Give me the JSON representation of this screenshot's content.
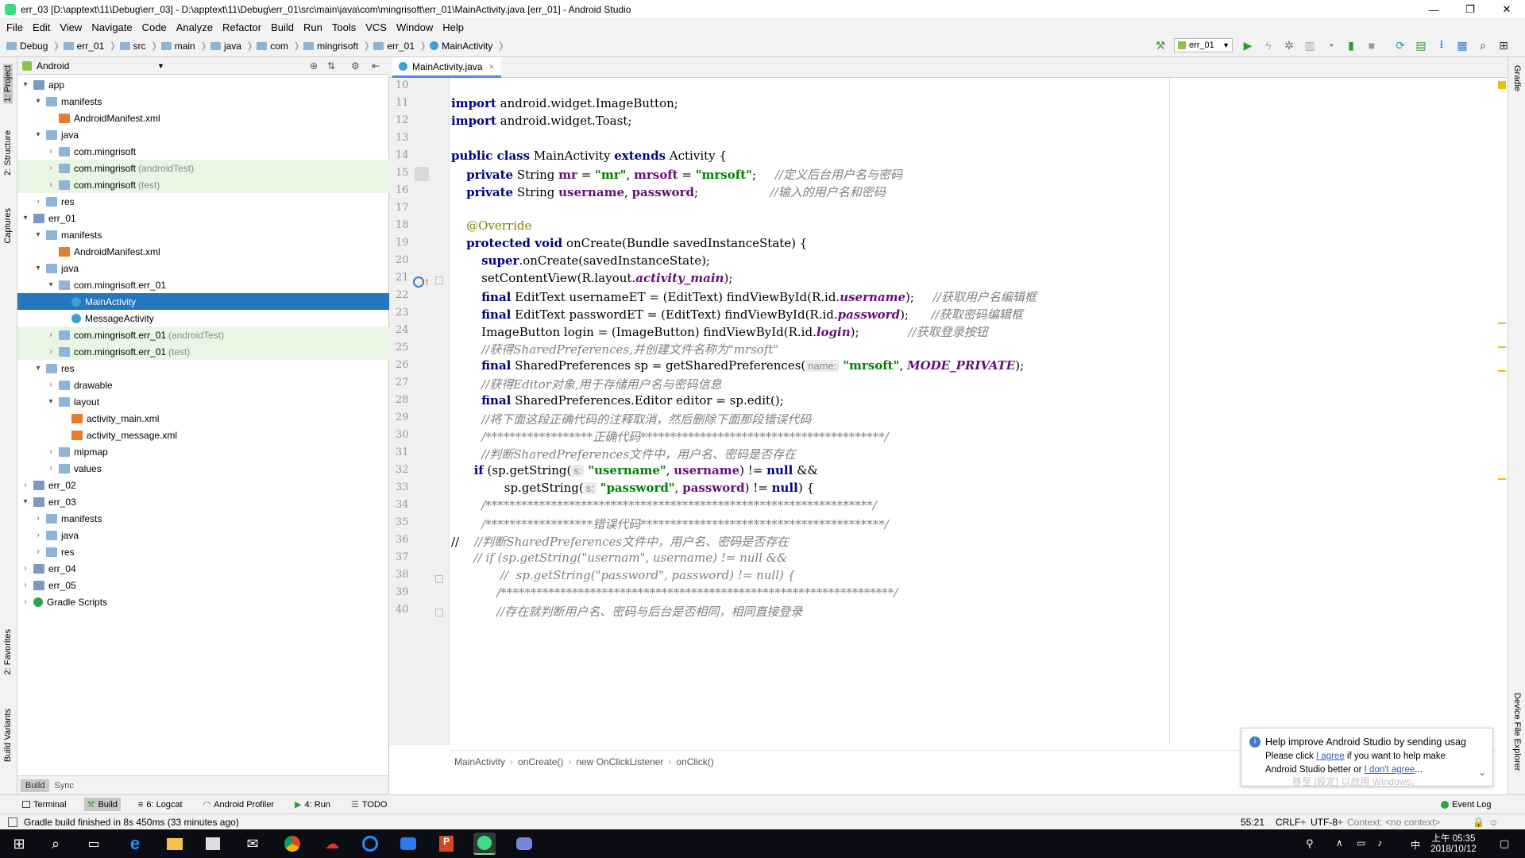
{
  "window": {
    "title": "err_03 [D:\\apptext\\11\\Debug\\err_03] - D:\\apptext\\11\\Debug\\err_01\\src\\main\\java\\com\\mingrisoft\\err_01\\MainActivity.java [err_01] - Android Studio",
    "minimize": "—",
    "maximize": "❐",
    "close": "✕"
  },
  "menu": [
    "File",
    "Edit",
    "View",
    "Navigate",
    "Code",
    "Analyze",
    "Refactor",
    "Build",
    "Run",
    "Tools",
    "VCS",
    "Window",
    "Help"
  ],
  "breadcrumbs": [
    "Debug",
    "err_01",
    "src",
    "main",
    "java",
    "com",
    "mingrisoft",
    "err_01",
    "MainActivity"
  ],
  "run_config": "err_01",
  "left_strip": {
    "project": "1: Project",
    "structure": "2: Structure",
    "captures": "Captures",
    "favorites": "2: Favorites",
    "build_variants": "Build Variants"
  },
  "right_strip": {
    "gradle": "Gradle",
    "device_explorer": "Device File Explorer"
  },
  "project_panel": {
    "view_selector": "Android",
    "tree": [
      {
        "label": "app",
        "level": 0,
        "arrow": "▾",
        "icon": "mod"
      },
      {
        "label": "manifests",
        "level": 1,
        "arrow": "▾",
        "icon": "folder"
      },
      {
        "label": "AndroidManifest.xml",
        "level": 2,
        "arrow": "",
        "icon": "xml"
      },
      {
        "label": "java",
        "level": 1,
        "arrow": "▾",
        "icon": "folder"
      },
      {
        "label": "com.mingrisoft",
        "level": 2,
        "arrow": "›",
        "icon": "folder"
      },
      {
        "label": "com.mingrisoft",
        "suffix": "(androidTest)",
        "level": 2,
        "arrow": "›",
        "icon": "folder",
        "hl": true
      },
      {
        "label": "com.mingrisoft",
        "suffix": "(test)",
        "level": 2,
        "arrow": "›",
        "icon": "folder",
        "hl": true
      },
      {
        "label": "res",
        "level": 1,
        "arrow": "›",
        "icon": "folder"
      },
      {
        "label": "err_01",
        "level": 0,
        "arrow": "▾",
        "icon": "mod"
      },
      {
        "label": "manifests",
        "level": 1,
        "arrow": "▾",
        "icon": "folder"
      },
      {
        "label": "AndroidManifest.xml",
        "level": 2,
        "arrow": "",
        "icon": "xml"
      },
      {
        "label": "java",
        "level": 1,
        "arrow": "▾",
        "icon": "folder"
      },
      {
        "label": "com.mingrisoft.err_01",
        "level": 2,
        "arrow": "▾",
        "icon": "folder"
      },
      {
        "label": "MainActivity",
        "level": 3,
        "arrow": "",
        "icon": "cls",
        "sel": true
      },
      {
        "label": "MessageActivity",
        "level": 3,
        "arrow": "",
        "icon": "cls"
      },
      {
        "label": "com.mingrisoft.err_01",
        "suffix": "(androidTest)",
        "level": 2,
        "arrow": "›",
        "icon": "folder",
        "hl": true
      },
      {
        "label": "com.mingrisoft.err_01",
        "suffix": "(test)",
        "level": 2,
        "arrow": "›",
        "icon": "folder",
        "hl": true
      },
      {
        "label": "res",
        "level": 1,
        "arrow": "▾",
        "icon": "folder"
      },
      {
        "label": "drawable",
        "level": 2,
        "arrow": "›",
        "icon": "folder"
      },
      {
        "label": "layout",
        "level": 2,
        "arrow": "▾",
        "icon": "folder"
      },
      {
        "label": "activity_main.xml",
        "level": 3,
        "arrow": "",
        "icon": "xml"
      },
      {
        "label": "activity_message.xml",
        "level": 3,
        "arrow": "",
        "icon": "xml"
      },
      {
        "label": "mipmap",
        "level": 2,
        "arrow": "›",
        "icon": "folder"
      },
      {
        "label": "values",
        "level": 2,
        "arrow": "›",
        "icon": "folder"
      },
      {
        "label": "err_02",
        "level": 0,
        "arrow": "›",
        "icon": "mod"
      },
      {
        "label": "err_03",
        "level": 0,
        "arrow": "▾",
        "icon": "mod"
      },
      {
        "label": "manifests",
        "level": 1,
        "arrow": "›",
        "icon": "folder"
      },
      {
        "label": "java",
        "level": 1,
        "arrow": "›",
        "icon": "folder"
      },
      {
        "label": "res",
        "level": 1,
        "arrow": "›",
        "icon": "folder"
      },
      {
        "label": "err_04",
        "level": 0,
        "arrow": "›",
        "icon": "mod"
      },
      {
        "label": "err_05",
        "level": 0,
        "arrow": "›",
        "icon": "mod"
      },
      {
        "label": "Gradle Scripts",
        "level": 0,
        "arrow": "›",
        "icon": "gr"
      }
    ]
  },
  "build_tabs": [
    "Build",
    "Sync"
  ],
  "editor": {
    "tab": "MainActivity.java",
    "tab_close": "×",
    "line_numbers": [
      "10",
      "11",
      "12",
      "13",
      "14",
      "15",
      "16",
      "17",
      "18",
      "19",
      "20",
      "21",
      "22",
      "23",
      "24",
      "25",
      "26",
      "27",
      "28",
      "29",
      "30",
      "31",
      "32",
      "33",
      "34",
      "35",
      "36",
      "37",
      "38",
      "39",
      "40"
    ],
    "lines": [
      [],
      [
        [
          "import",
          "kw"
        ],
        [
          " android.widget.ImageButton;",
          ""
        ]
      ],
      [
        [
          "import",
          "kw"
        ],
        [
          " android.widget.Toast;",
          ""
        ]
      ],
      [],
      [
        [
          "public class",
          "kw"
        ],
        [
          " MainActivity ",
          ""
        ],
        [
          "extends",
          "kw"
        ],
        [
          " Activity {",
          ""
        ]
      ],
      [
        [
          "    ",
          ""
        ],
        [
          "private",
          "kw"
        ],
        [
          " String ",
          ""
        ],
        [
          "mr",
          "fld"
        ],
        [
          " = ",
          ""
        ],
        [
          "\"mr\"",
          "str"
        ],
        [
          ", ",
          ""
        ],
        [
          "mrsoft",
          "fld"
        ],
        [
          " = ",
          ""
        ],
        [
          "\"mrsoft\"",
          "str"
        ],
        [
          ";     ",
          ""
        ],
        [
          "//定义后台用户名与密码",
          "cm"
        ]
      ],
      [
        [
          "    ",
          ""
        ],
        [
          "private",
          "kw"
        ],
        [
          " String ",
          ""
        ],
        [
          "username",
          "fld"
        ],
        [
          ", ",
          ""
        ],
        [
          "password",
          "fld"
        ],
        [
          ";                   ",
          ""
        ],
        [
          "//输入的用户名和密码",
          "cm"
        ]
      ],
      [],
      [
        [
          "    ",
          ""
        ],
        [
          "@Override",
          "ann"
        ]
      ],
      [
        [
          "    ",
          ""
        ],
        [
          "protected void",
          "kw"
        ],
        [
          " onCreate(Bundle savedInstanceState) {",
          ""
        ]
      ],
      [
        [
          "        ",
          ""
        ],
        [
          "super",
          "kw"
        ],
        [
          ".onCreate(savedInstanceState);",
          ""
        ]
      ],
      [
        [
          "        setContentView(R.layout.",
          ""
        ],
        [
          "activity_main",
          "fldi"
        ],
        [
          ");",
          ""
        ]
      ],
      [
        [
          "        ",
          ""
        ],
        [
          "final",
          "kw"
        ],
        [
          " EditText usernameET = (EditText) findViewById(R.id.",
          ""
        ],
        [
          "username",
          "fldi"
        ],
        [
          ");     ",
          ""
        ],
        [
          "//获取用户名编辑框",
          "cm"
        ]
      ],
      [
        [
          "        ",
          ""
        ],
        [
          "final",
          "kw"
        ],
        [
          " EditText passwordET = (EditText) findViewById(R.id.",
          ""
        ],
        [
          "password",
          "fldi"
        ],
        [
          ");      ",
          ""
        ],
        [
          "//获取密码编辑框",
          "cm"
        ]
      ],
      [
        [
          "        ImageButton login = (ImageButton) findViewById(R.id.",
          ""
        ],
        [
          "login",
          "fldi"
        ],
        [
          ");             ",
          ""
        ],
        [
          "//获取登录按钮",
          "cm"
        ]
      ],
      [
        [
          "        ",
          ""
        ],
        [
          "//获得SharedPreferences,并创建文件名称为\"mrsoft\"",
          "cm"
        ]
      ],
      [
        [
          "        ",
          ""
        ],
        [
          "final",
          "kw"
        ],
        [
          " SharedPreferences sp = getSharedPreferences(",
          ""
        ],
        [
          "name:",
          "hint"
        ],
        [
          " ",
          ""
        ],
        [
          "\"mrsoft\"",
          "str"
        ],
        [
          ", ",
          ""
        ],
        [
          "MODE_PRIVATE",
          "fldi"
        ],
        [
          ");",
          ""
        ]
      ],
      [
        [
          "        ",
          ""
        ],
        [
          "//获得Editor对象,用于存储用户名与密码信息",
          "cm"
        ]
      ],
      [
        [
          "        ",
          ""
        ],
        [
          "final",
          "kw"
        ],
        [
          " SharedPreferences.Editor editor = sp.edit();",
          ""
        ]
      ],
      [
        [
          "        ",
          ""
        ],
        [
          "//将下面这段正确代码的注释取消，然后删除下面那段错误代码",
          "cm"
        ]
      ],
      [
        [
          "        ",
          ""
        ],
        [
          "/******************正确代码*****************************************/",
          "cm"
        ]
      ],
      [
        [
          "        ",
          ""
        ],
        [
          "//判断SharedPreferences文件中，用户名、密码是否存在",
          "cm"
        ]
      ],
      [
        [
          "      ",
          ""
        ],
        [
          "if",
          "kw"
        ],
        [
          " (sp.getString(",
          ""
        ],
        [
          "s:",
          "hint"
        ],
        [
          " ",
          ""
        ],
        [
          "\"username\"",
          "str"
        ],
        [
          ", ",
          ""
        ],
        [
          "username",
          "fld"
        ],
        [
          ") != ",
          ""
        ],
        [
          "null",
          "kw"
        ],
        [
          " &&",
          ""
        ]
      ],
      [
        [
          "              sp.getString(",
          ""
        ],
        [
          "s:",
          "hint"
        ],
        [
          " ",
          ""
        ],
        [
          "\"password\"",
          "str"
        ],
        [
          ", ",
          ""
        ],
        [
          "password",
          "fld"
        ],
        [
          ") != ",
          ""
        ],
        [
          "null",
          "kw"
        ],
        [
          ") {",
          ""
        ]
      ],
      [
        [
          "        ",
          ""
        ],
        [
          "/*****************************************************************/",
          "cm"
        ]
      ],
      [
        [
          "        ",
          ""
        ],
        [
          "/******************错误代码*****************************************/",
          "cm"
        ]
      ],
      [
        [
          "//    ",
          ""
        ],
        [
          "//判断SharedPreferences文件中，用户名、密码是否存在",
          "cm"
        ]
      ],
      [
        [
          "      ",
          ""
        ],
        [
          "// if (sp.getString(\"usernam\", username) != null &&",
          "cm"
        ]
      ],
      [
        [
          "             ",
          ""
        ],
        [
          "//  sp.getString(\"password\", password) != null) {",
          "cm"
        ]
      ],
      [
        [
          "            ",
          ""
        ],
        [
          "/******************************************************************/",
          "cm"
        ]
      ],
      [
        [
          "            ",
          ""
        ],
        [
          "//存在就判断用户名、密码与后台是否相同，相同直接登录",
          "cm"
        ]
      ]
    ]
  },
  "editor_breadcrumb": [
    "MainActivity",
    "onCreate()",
    "new OnClickListener",
    "onClick()"
  ],
  "notification": {
    "title": "Help improve Android Studio by sending usag",
    "line1_pre": "Please click ",
    "agree": "I agree",
    "line1_post": " if you want to help make",
    "line2_pre": "Android Studio better or ",
    "disagree": "I don't agree",
    "line2_post": "...",
    "watermark": "移至 [設定] 以啟用 Windows。"
  },
  "bottom_tools": [
    "Terminal",
    "Build",
    "6: Logcat",
    "Android Profiler",
    "4: Run",
    "TODO"
  ],
  "event_log": "Event Log",
  "status": {
    "message": "Gradle build finished in 8s 450ms (33 minutes ago)",
    "position": "55:21",
    "line_sep": "CRLF÷",
    "encoding": "UTF-8÷",
    "context": "Context: <no context>"
  },
  "taskbar": {
    "time": "上午 05:35",
    "date": "2018/10/12",
    "ime": "中"
  }
}
